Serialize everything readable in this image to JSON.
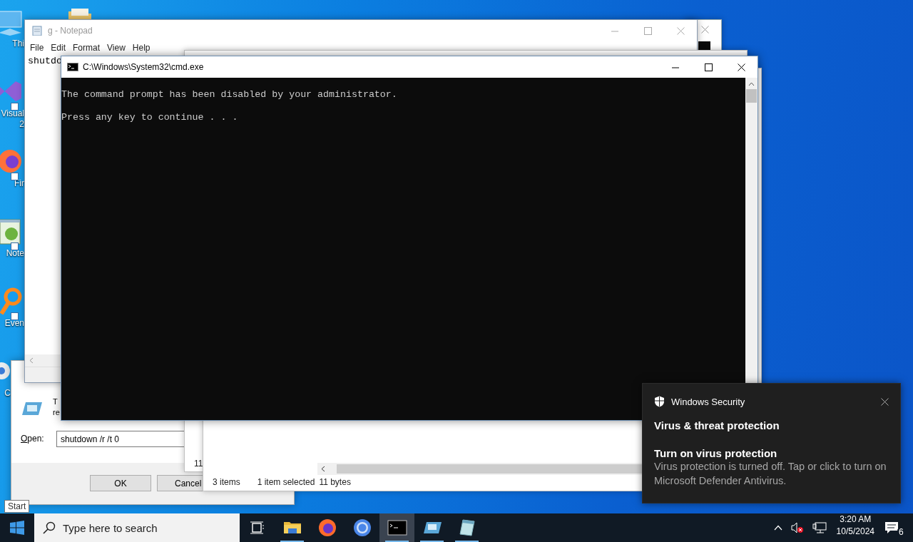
{
  "desktop_icons": [
    {
      "kind": "pc",
      "label": [
        "Thi"
      ]
    },
    {
      "kind": "studio",
      "label": [
        "Visual",
        "2"
      ]
    },
    {
      "kind": "firefox",
      "label": [
        "Fir"
      ]
    },
    {
      "kind": "notepad",
      "label": [
        "Note"
      ]
    },
    {
      "kind": "search-app",
      "label": [
        "Even"
      ]
    },
    {
      "kind": "chrome",
      "label": [
        "C"
      ]
    },
    {
      "kind": "folder"
    }
  ],
  "notepad": {
    "title": "g - Notepad",
    "menu": [
      "File",
      "Edit",
      "Format",
      "View",
      "Help"
    ],
    "text": "shutdo"
  },
  "run_dialog": {
    "description": [
      "T",
      "re"
    ],
    "open_label": "Open:",
    "value": "shutdown /r /t 0",
    "buttons": [
      "OK",
      "Cancel"
    ]
  },
  "explorer_back": {
    "text": "11"
  },
  "explorer": {
    "status": [
      "3 items",
      "1 item selected",
      "11 bytes"
    ]
  },
  "cmd": {
    "title": "C:\\Windows\\System32\\cmd.exe",
    "lines": [
      "The command prompt has been disabled by your administrator.",
      "Press any key to continue . . ."
    ]
  },
  "toast": {
    "app": "Windows Security",
    "heading": "Virus & threat protection",
    "title": "Turn on virus protection",
    "body": "Virus protection is turned off. Tap or click to turn on Microsoft Defender Antivirus."
  },
  "tooltip": "Start",
  "taskbar": {
    "search_placeholder": "Type here to search",
    "apps": [
      {
        "kind": "explorer",
        "running": true,
        "selected": false
      },
      {
        "kind": "firefox",
        "running": false,
        "selected": false
      },
      {
        "kind": "chrome",
        "running": false,
        "selected": false
      },
      {
        "kind": "cmd",
        "running": true,
        "selected": true
      },
      {
        "kind": "run",
        "running": true,
        "selected": false
      },
      {
        "kind": "notepad",
        "running": true,
        "selected": false
      }
    ],
    "time": "3:20 AM",
    "date": "10/5/2024",
    "notification_count": "6"
  }
}
